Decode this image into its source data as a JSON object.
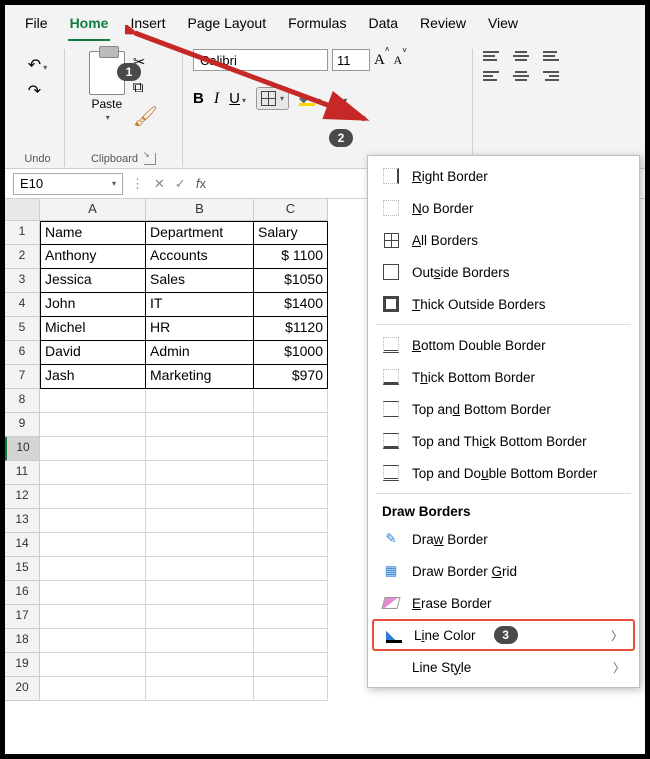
{
  "menu": {
    "file": "File",
    "home": "Home",
    "insert": "Insert",
    "layout": "Page Layout",
    "formulas": "Formulas",
    "data": "Data",
    "review": "Review",
    "view": "View"
  },
  "ribbon": {
    "undo_label": "Undo",
    "paste_label": "Paste",
    "clipboard_label": "Clipboard",
    "font_name": "Calibri",
    "font_size": "11",
    "bold": "B",
    "italic": "I",
    "underline": "U"
  },
  "namebox": "E10",
  "columns": [
    "A",
    "B",
    "C"
  ],
  "rows": [
    "1",
    "2",
    "3",
    "4",
    "5",
    "6",
    "7",
    "8",
    "9",
    "10",
    "11",
    "12",
    "13",
    "14",
    "15",
    "16",
    "17",
    "18",
    "19",
    "20"
  ],
  "table": {
    "headers": [
      "Name",
      "Department",
      "Salary"
    ],
    "data": [
      [
        "Anthony",
        "Accounts",
        "$ 1100"
      ],
      [
        "Jessica",
        "Sales",
        "$1050"
      ],
      [
        "John",
        "IT",
        "$1400"
      ],
      [
        "Michel",
        "HR",
        "$1120"
      ],
      [
        "David",
        "Admin",
        "$1000"
      ],
      [
        "Jash",
        "Marketing",
        "$970"
      ]
    ]
  },
  "dropdown": {
    "right": "Right Border",
    "none": "No Border",
    "all": "All Borders",
    "outside": "Outside Borders",
    "thick_outside": "Thick Outside Borders",
    "bottom_double": "Bottom Double Border",
    "thick_bottom": "Thick Bottom Border",
    "top_bottom": "Top and Bottom Border",
    "top_thick_bottom": "Top and Thick Bottom Border",
    "top_double_bottom": "Top and Double Bottom Border",
    "draw_head": "Draw Borders",
    "draw": "Draw Border",
    "draw_grid": "Draw Border Grid",
    "erase": "Erase Border",
    "line_color": "Line Color",
    "line_style": "Line Style"
  },
  "badges": {
    "b1": "1",
    "b2": "2",
    "b3": "3"
  }
}
